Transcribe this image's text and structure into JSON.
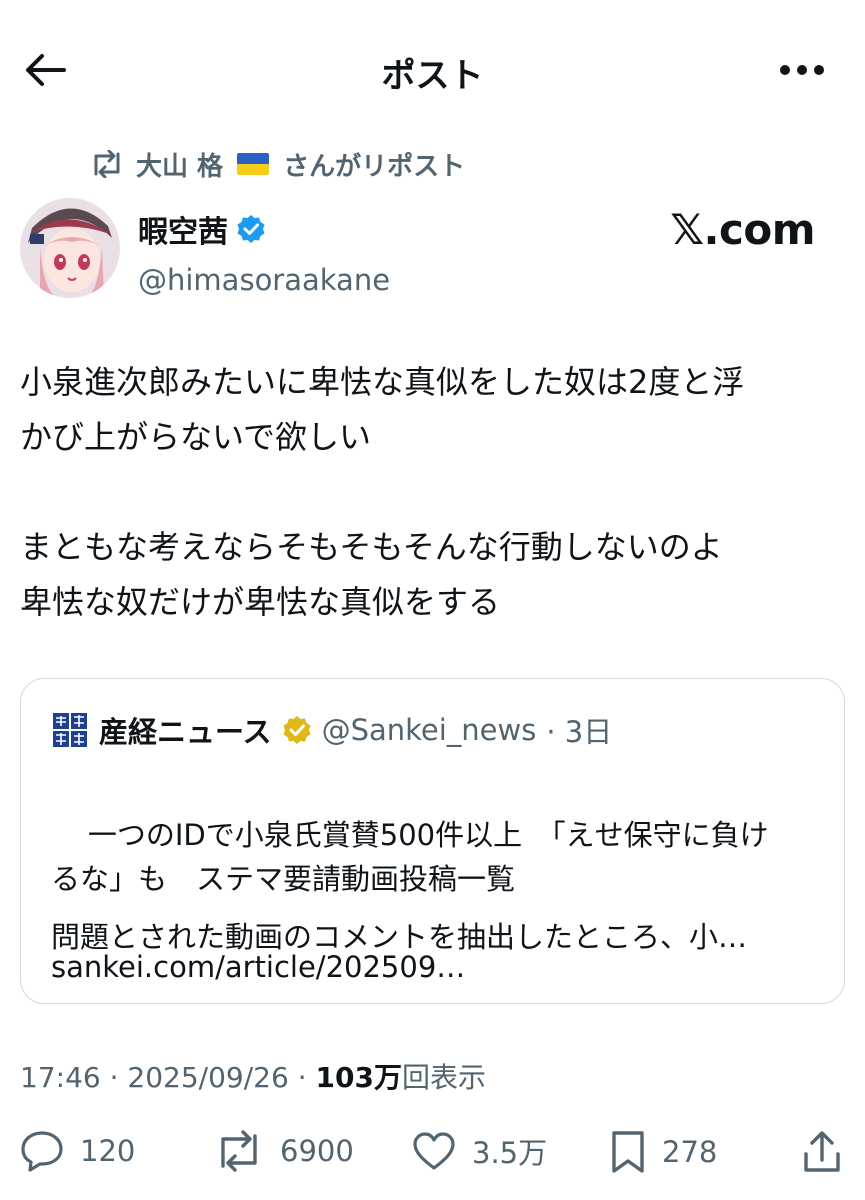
{
  "header": {
    "title": "ポスト"
  },
  "repost": {
    "reposter": "大山 格",
    "suffix": "さんがリポスト"
  },
  "author": {
    "name": "暇空茜",
    "handle": "@himasoraakane"
  },
  "watermark": "𝕏.com",
  "tweet": {
    "text": "小泉進次郎みたいに卑怯な真似をした奴は2度と浮\nかび上がらないで欲しい\n\nまともな考えならそもそもそんな行動しないのよ\n卑怯な奴だけが卑怯な真似をする"
  },
  "quote": {
    "name": "産経ニュース",
    "handle": "@Sankei_news",
    "time": "· 3日",
    "text": "一つのIDで小泉氏賞賛500件以上　「えせ保守に負け\nるな」も　ステマ要請動画投稿一覧",
    "link": "sankei.com/article/202509…",
    "excerpt": "問題とされた動画のコメントを抽出したところ、小…"
  },
  "meta": {
    "time": "17:46",
    "date": "2025/09/26",
    "views": "103万",
    "views_label": "回表示"
  },
  "actions": {
    "replies": "120",
    "reposts": "6900",
    "likes": "3.5万",
    "bookmarks": "278"
  },
  "colors": {
    "text": "#0f1419",
    "secondary": "#536471",
    "verified_blue": "#1d9bf0",
    "verified_gold": "#e2b719",
    "border": "#cfd9de"
  },
  "icons": [
    "back-arrow-icon",
    "more-icon",
    "repost-icon",
    "verified-badge-icon",
    "gold-verified-badge-icon",
    "reply-icon",
    "like-icon",
    "bookmark-icon",
    "share-icon"
  ]
}
